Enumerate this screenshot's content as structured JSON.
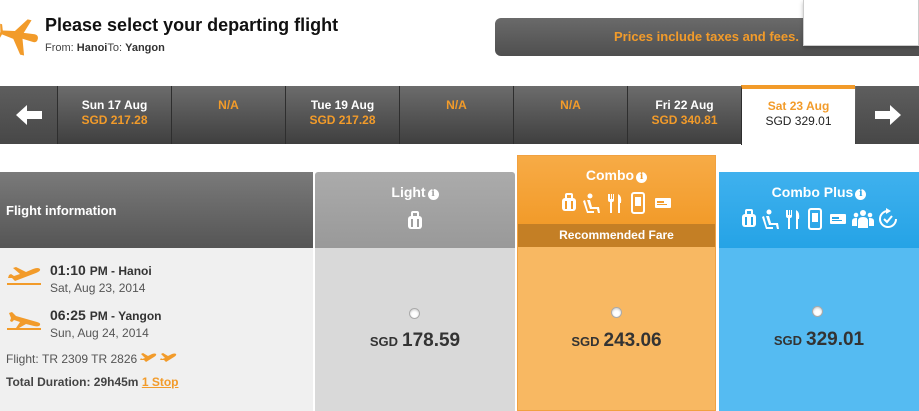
{
  "header": {
    "title": "Please select your departing flight",
    "route_prefix": "From:",
    "route_from": "Hanoi",
    "route_to_label": "To:",
    "route_to": "Yangon",
    "notice": "Prices include taxes and fees."
  },
  "date_bar": {
    "cells": [
      {
        "day": "Sun 17 Aug",
        "price": "SGD 217.28"
      },
      {
        "day": "N/A",
        "price": ""
      },
      {
        "day": "Tue 19 Aug",
        "price": "SGD 217.28"
      },
      {
        "day": "N/A",
        "price": ""
      },
      {
        "day": "N/A",
        "price": ""
      },
      {
        "day": "Fri 22 Aug",
        "price": "SGD 340.81"
      },
      {
        "day": "Sat 23 Aug",
        "price": "SGD 329.01",
        "selected": true
      }
    ]
  },
  "flight_info": {
    "heading": "Flight information",
    "depart": {
      "time": "01:10",
      "ampm": "PM",
      "sep": " - ",
      "city": "Hanoi",
      "date": "Sat, Aug 23, 2014"
    },
    "arrive": {
      "time": "06:25",
      "ampm": "PM",
      "sep": " - ",
      "city": "Yangon",
      "date": "Sun, Aug 24, 2014"
    },
    "flight_label": "Flight:",
    "flight_numbers": "TR 2309 TR 2826",
    "duration_label": "Total Duration:",
    "duration": "29h45m",
    "stops": "1 Stop"
  },
  "fares": {
    "light": {
      "title": "Light",
      "currency": "SGD",
      "amount": "178.59",
      "icons": [
        "bag-icon"
      ]
    },
    "combo": {
      "title": "Combo",
      "badge": "Recommended Fare",
      "currency": "SGD",
      "amount": "243.06",
      "icons": [
        "bag-icon",
        "seat-icon",
        "meal-icon",
        "device-icon",
        "ticket-icon"
      ]
    },
    "combo_plus": {
      "title": "Combo Plus",
      "currency": "SGD",
      "amount": "329.01",
      "icons": [
        "bag-icon",
        "seat-icon",
        "meal-icon",
        "device-icon",
        "ticket-icon",
        "group-icon",
        "change-icon"
      ]
    }
  },
  "colors": {
    "accent": "#f29b2a",
    "dark_bar": "#4f4f4f",
    "light_fare": "#d9d9d9",
    "combo_fare": "#f8b862",
    "plus_fare": "#55bbf2"
  },
  "info_icon_glyph": "i"
}
